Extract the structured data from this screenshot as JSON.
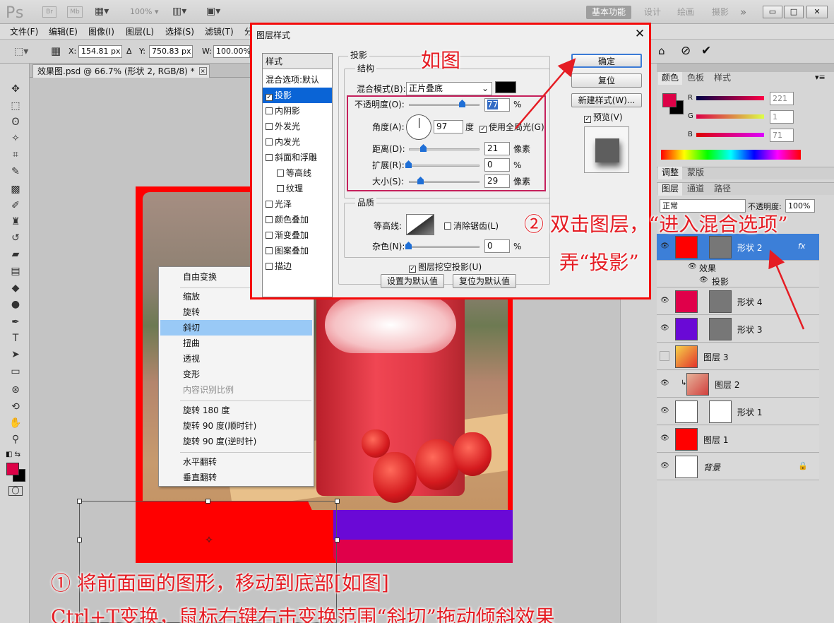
{
  "titlebar": {
    "logo": "Ps",
    "br": "Br",
    "mb": "Mb",
    "zoom": "100%",
    "workspaces": [
      "基本功能",
      "设计",
      "绘画",
      "摄影"
    ],
    "more": "»"
  },
  "menu": [
    "文件(F)",
    "编辑(E)",
    "图像(I)",
    "图层(L)",
    "选择(S)",
    "滤镜(T)",
    "分"
  ],
  "options": {
    "x_label": "X:",
    "x_value": "154.81 px",
    "delta": "Δ",
    "y_label": "Y:",
    "y_value": "750.83 px",
    "w_label": "W:",
    "w_value": "100.00%"
  },
  "doc_tab": {
    "title": "效果图.psd @ 66.7% (形状 2, RGB/8) *",
    "close": "×"
  },
  "context_menu": {
    "items": [
      "自由变换",
      "缩放",
      "旋转",
      "斜切",
      "扭曲",
      "透视",
      "变形",
      "内容识别比例",
      "旋转 180 度",
      "旋转 90 度(顺时针)",
      "旋转 90 度(逆时针)",
      "水平翻转",
      "垂直翻转"
    ],
    "selected": "斜切",
    "disabled": "内容识别比例"
  },
  "dialog": {
    "title": "图层样式",
    "close": "✕",
    "styles_header": "样式",
    "styles": [
      "混合选项:默认",
      "投影",
      "内阴影",
      "外发光",
      "内发光",
      "斜面和浮雕",
      "等高线",
      "纹理",
      "光泽",
      "颜色叠加",
      "渐变叠加",
      "图案叠加",
      "描边"
    ],
    "section": "投影",
    "structure": "结构",
    "quality": "品质",
    "blend_mode_label": "混合模式(B):",
    "blend_mode": "正片叠底",
    "opacity_label": "不透明度(O):",
    "opacity": "77",
    "pct": "%",
    "angle_label": "角度(A):",
    "angle": "97",
    "degree": "度",
    "global_light": "使用全局光(G)",
    "distance_label": "距离(D):",
    "distance": "21",
    "px": "像素",
    "spread_label": "扩展(R):",
    "spread": "0",
    "size_label": "大小(S):",
    "size": "29",
    "contour_label": "等高线:",
    "antialias": "消除锯齿(L)",
    "noise_label": "杂色(N):",
    "noise": "0",
    "knockout": "图层挖空投影(U)",
    "make_default": "设置为默认值",
    "reset_default": "复位为默认值",
    "ok": "确定",
    "reset": "复位",
    "new_style": "新建样式(W)...",
    "preview": "预览(V)",
    "shadow_color": "#000000"
  },
  "color_panel": {
    "tabs": [
      "颜色",
      "色板",
      "样式"
    ],
    "r_label": "R",
    "r": "221",
    "g_label": "G",
    "g": "1",
    "b_label": "B",
    "b": "71",
    "fg": "#dd0147"
  },
  "adjust_tabs": [
    "调整",
    "蒙版"
  ],
  "layers_panel": {
    "tabs": [
      "图层",
      "通道",
      "路径"
    ],
    "blend": "正常",
    "opacity_label": "不透明度:",
    "opacity": "100%",
    "layers": [
      {
        "name": "形状 2",
        "color": "#ff0000",
        "selected": true,
        "fx": "fx",
        "effects_label": "效果",
        "effect": "投影"
      },
      {
        "name": "形状 4",
        "color": "#e0004a"
      },
      {
        "name": "形状 3",
        "color": "#6a09d6"
      },
      {
        "name": "图层 3",
        "color": "#f0c030"
      },
      {
        "name": "图层 2",
        "color": "#e89a80"
      },
      {
        "name": "形状 1",
        "color": "#ffffff"
      },
      {
        "name": "图层 1",
        "color": "#ff0000"
      },
      {
        "name": "背景",
        "color": "#ffffff"
      }
    ]
  },
  "annotations": {
    "a1": "如图",
    "a2_line1": "② 双击图层，“进入混合选项”",
    "a2_line2": "弄“投影”",
    "a3_line1": "① 将前面画的图形，移动到底部[如图]",
    "a3_line2": "Ctrl+T变换，鼠标右键右击变换范围“斜切”拖动倾斜效果"
  },
  "colors": {
    "accent_red": "#e51c23",
    "selection_blue": "#0a64d6",
    "fg_color": "#dd0147"
  }
}
